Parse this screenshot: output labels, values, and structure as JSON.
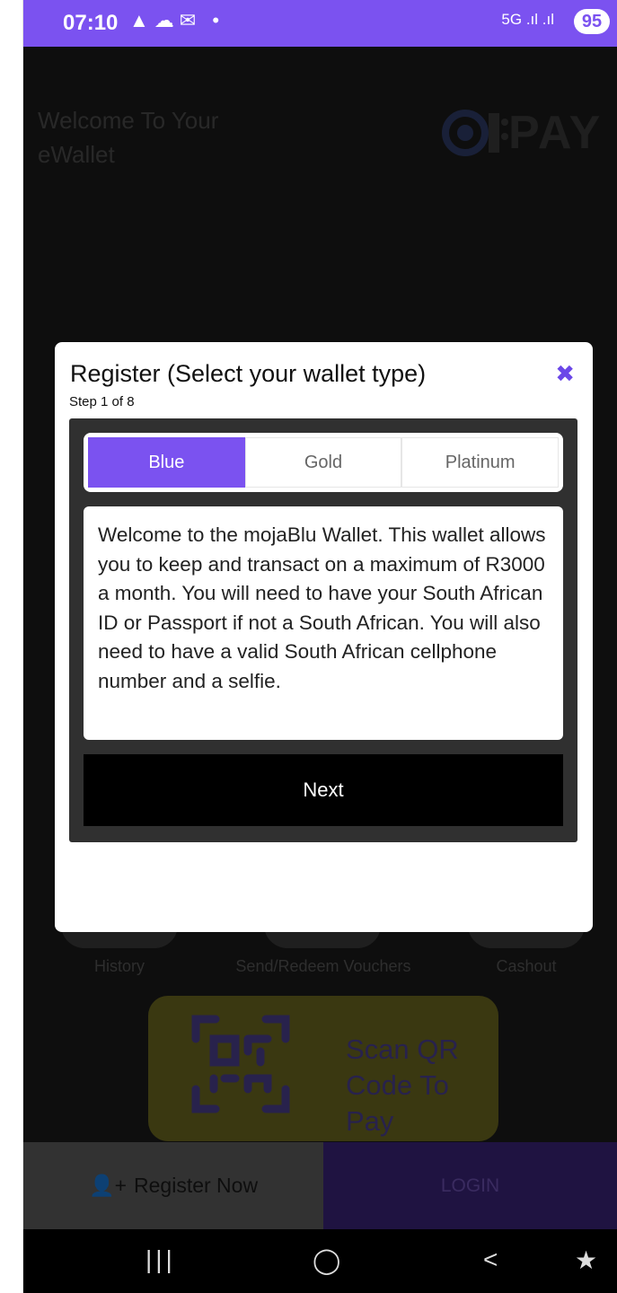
{
  "status_bar": {
    "time": "07:10",
    "left_icons": "▲☁✉ •",
    "right_icons": "5G .ıl .ıl",
    "battery": "95"
  },
  "app": {
    "welcome_text": "Welcome To Your eWallet",
    "logo_text": "PAY",
    "actions": [
      "History",
      "Send/Redeem Vouchers",
      "Cashout"
    ],
    "scan_label": "Scan QR Code To Pay",
    "register_label": "Register Now",
    "login_label": "LOGIN"
  },
  "modal": {
    "title": "Register (Select your wallet type)",
    "step": "Step 1 of 8",
    "close_icon": "close-icon",
    "tabs": [
      {
        "label": "Blue",
        "active": true
      },
      {
        "label": "Gold",
        "active": false
      },
      {
        "label": "Platinum",
        "active": false
      }
    ],
    "description": "Welcome to the mojaBlu Wallet. This wallet allows you to keep and transact on a maximum of R3000 a month. You will need to have your South African ID or Passport if not a South African. You will also need to have a valid South African cellphone number and a selfie.",
    "next_label": "Next"
  },
  "colors": {
    "accent": "#7b52f0",
    "scan_box": "#6b6720"
  }
}
